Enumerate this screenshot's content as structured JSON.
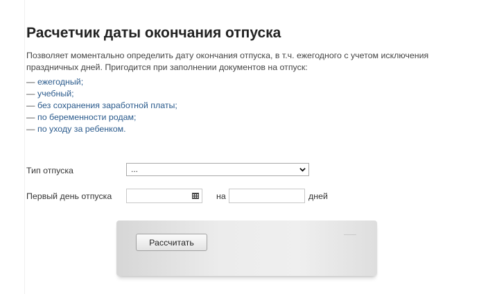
{
  "page": {
    "title": "Расчетчик даты окончания отпуска",
    "description": "Позволяет моментально определить дату окончания отпуска, в т.ч. ежегодного с учетом исключения праздничных дней. Пригодится при заполнении документов на отпуск:",
    "dash": "—",
    "leave_types": [
      "ежегодный;",
      "учебный;",
      "без сохранения заработной платы;",
      "по беременности родам;",
      "по уходу за ребенком."
    ]
  },
  "form": {
    "leave_type_label": "Тип отпуска",
    "leave_type_selected": "...",
    "first_day_label": "Первый день отпуска",
    "first_day_value": "",
    "for_label": "на",
    "days_value": "",
    "days_label": "дней",
    "calculate_label": "Рассчитать"
  },
  "colors": {
    "link": "#2a5a8c",
    "text": "#333333"
  },
  "icons": {
    "select": "chevron-down-icon",
    "date": "calendar-icon"
  }
}
